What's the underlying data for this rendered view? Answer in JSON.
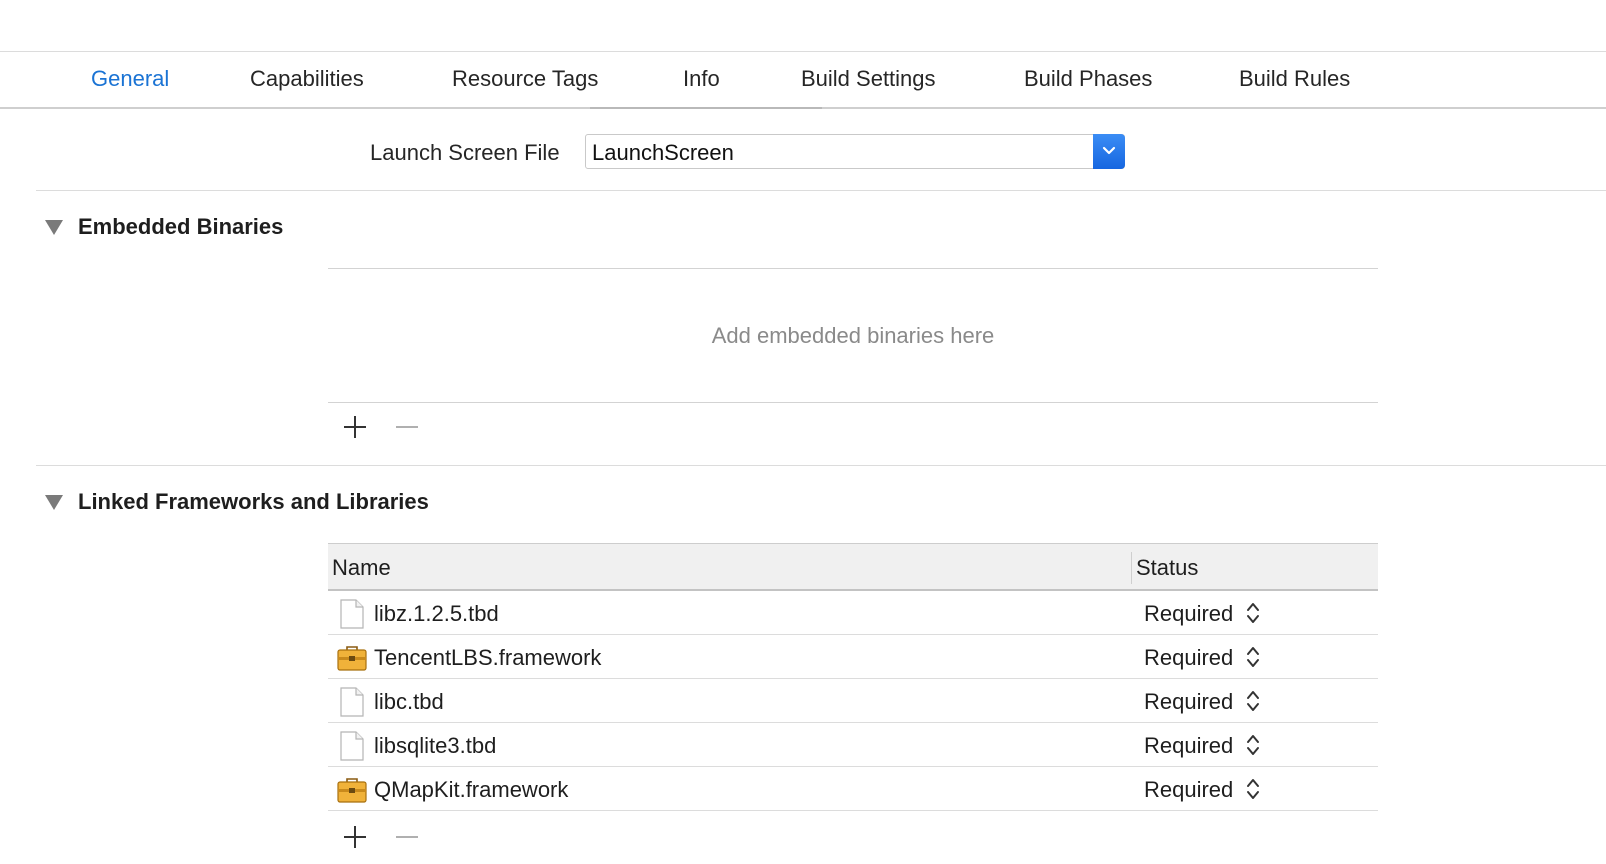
{
  "tabs": [
    {
      "label": "General",
      "active": true
    },
    {
      "label": "Capabilities",
      "active": false
    },
    {
      "label": "Resource Tags",
      "active": false
    },
    {
      "label": "Info",
      "active": false
    },
    {
      "label": "Build Settings",
      "active": false
    },
    {
      "label": "Build Phases",
      "active": false
    },
    {
      "label": "Build Rules",
      "active": false
    }
  ],
  "launch_screen": {
    "label": "Launch Screen File",
    "value": "LaunchScreen"
  },
  "embedded_binaries": {
    "title": "Embedded Binaries",
    "empty_text": "Add embedded binaries here"
  },
  "linked_frameworks": {
    "title": "Linked Frameworks and Libraries",
    "columns": {
      "name": "Name",
      "status": "Status"
    },
    "rows": [
      {
        "name": "libz.1.2.5.tbd",
        "icon": "document-icon",
        "status": "Required"
      },
      {
        "name": "TencentLBS.framework",
        "icon": "framework-toolbox-icon",
        "status": "Required"
      },
      {
        "name": "libc.tbd",
        "icon": "document-icon",
        "status": "Required"
      },
      {
        "name": "libsqlite3.tbd",
        "icon": "document-icon",
        "status": "Required"
      },
      {
        "name": "QMapKit.framework",
        "icon": "framework-toolbox-icon",
        "status": "Required"
      }
    ]
  },
  "colors": {
    "accent": "#1a73d4",
    "popup_button": "#2a7ae8",
    "framework_icon": "#e8a82a"
  }
}
